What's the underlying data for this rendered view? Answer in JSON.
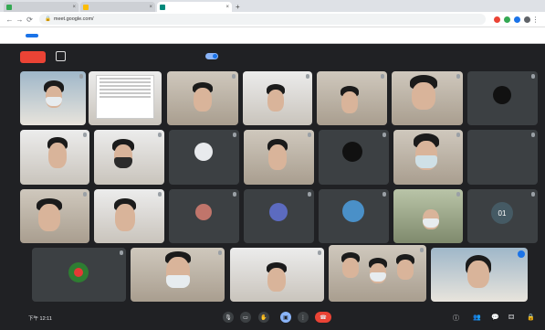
{
  "browser": {
    "tabs": [
      {
        "title": "",
        "favicon_color": "#34a853",
        "active": false
      },
      {
        "title": "",
        "favicon_color": "#fbbc04",
        "active": false
      },
      {
        "title": "",
        "favicon_color": "#00897b",
        "active": true
      }
    ],
    "url": "meet.google.com/",
    "infobar": {
      "message": "",
      "share_button": "",
      "hide_link": ""
    }
  },
  "meet": {
    "leave_label": "",
    "top_left_text": "",
    "top_mid_text": "",
    "top_right_text": ""
  },
  "tiles": [
    {
      "name": ""
    },
    {
      "name": ""
    },
    {
      "name": ""
    },
    {
      "name": ""
    },
    {
      "name": ""
    },
    {
      "name": ""
    },
    {
      "name": ""
    },
    {
      "name": ""
    },
    {
      "name": ""
    },
    {
      "name": ""
    },
    {
      "name": ""
    },
    {
      "name": ""
    },
    {
      "name": ""
    },
    {
      "name": ""
    },
    {
      "name": ""
    },
    {
      "name": ""
    },
    {
      "name": ""
    },
    {
      "name": "",
      "avatar_text": ""
    },
    {
      "name": "",
      "avatar_text": "01"
    },
    {
      "name": ""
    },
    {
      "name": ""
    },
    {
      "name": ""
    },
    {
      "name": ""
    },
    {
      "name": ""
    },
    {
      "name": ""
    },
    {
      "name": ""
    },
    {
      "name": ""
    }
  ],
  "bottom": {
    "time": "下午 12:11",
    "meeting_name": "",
    "people_count": ""
  },
  "colors": {
    "bg": "#202124",
    "tile": "#3c4043",
    "leave_red": "#ea4335",
    "accent_blue": "#8ab4f8"
  }
}
